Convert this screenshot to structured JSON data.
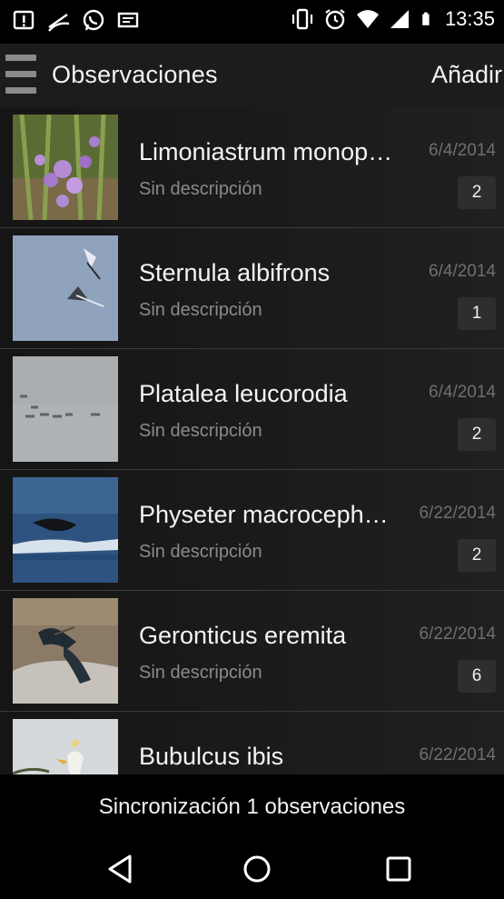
{
  "status_bar": {
    "time": "13:35",
    "left_icons": [
      "alert-icon",
      "signal-scribble-icon",
      "whatsapp-icon",
      "message-icon"
    ],
    "right_icons": [
      "vibrate-icon",
      "alarm-icon",
      "wifi-icon",
      "cell-signal-icon",
      "battery-icon"
    ]
  },
  "action_bar": {
    "title": "Observaciones",
    "add_label": "Añadir"
  },
  "observations": [
    {
      "name": "Limoniastrum monop…",
      "description": "Sin descripción",
      "date": "6/4/2014",
      "count": "2"
    },
    {
      "name": "Sternula albifrons",
      "description": "Sin descripción",
      "date": "6/4/2014",
      "count": "1"
    },
    {
      "name": "Platalea leucorodia",
      "description": "Sin descripción",
      "date": "6/4/2014",
      "count": "2"
    },
    {
      "name": "Physeter macroceph…",
      "description": "Sin descripción",
      "date": "6/22/2014",
      "count": "2"
    },
    {
      "name": "Geronticus eremita",
      "description": "Sin descripción",
      "date": "6/22/2014",
      "count": "6"
    },
    {
      "name": "Bubulcus ibis",
      "description": "",
      "date": "6/22/2014",
      "count": ""
    }
  ],
  "sync_bar": {
    "label": "Sincronización 1 observaciones"
  },
  "nav_bar": {
    "buttons": [
      "back-icon",
      "home-icon",
      "recents-icon"
    ]
  },
  "colors": {
    "background": "#131313",
    "text": "#f4f4f4",
    "secondary_text": "#8a8a8a",
    "badge": "#2e2e2e"
  }
}
